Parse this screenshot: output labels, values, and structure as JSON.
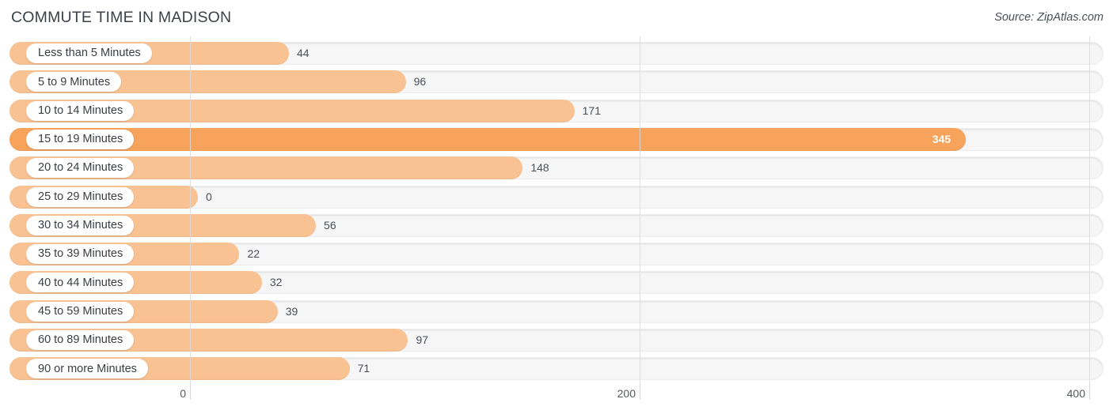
{
  "header": {
    "title": "COMMUTE TIME IN MADISON",
    "source": "Source: ZipAtlas.com"
  },
  "colors": {
    "bar_normal": "#f9c292",
    "bar_highlight": "#f7a35c",
    "track": "#f6f6f6",
    "gridline": "#d9d9d9",
    "text": "#3a3d44",
    "value_inside": "#ffffff"
  },
  "chart_data": {
    "type": "bar",
    "orientation": "horizontal",
    "title": "COMMUTE TIME IN MADISON",
    "xlabel": "",
    "ylabel": "",
    "xlim": [
      0,
      400
    ],
    "xticks": [
      0,
      200,
      400
    ],
    "xtick_labels": [
      "0",
      "200",
      "400"
    ],
    "grid": true,
    "legend": false,
    "highlight_category": "15 to 19 Minutes",
    "categories": [
      "Less than 5 Minutes",
      "5 to 9 Minutes",
      "10 to 14 Minutes",
      "15 to 19 Minutes",
      "20 to 24 Minutes",
      "25 to 29 Minutes",
      "30 to 34 Minutes",
      "35 to 39 Minutes",
      "40 to 44 Minutes",
      "45 to 59 Minutes",
      "60 to 89 Minutes",
      "90 or more Minutes"
    ],
    "values": [
      44,
      96,
      171,
      345,
      148,
      0,
      56,
      22,
      32,
      39,
      97,
      71
    ],
    "value_labels": [
      "44",
      "96",
      "171",
      "345",
      "148",
      "0",
      "56",
      "22",
      "32",
      "39",
      "97",
      "71"
    ]
  }
}
